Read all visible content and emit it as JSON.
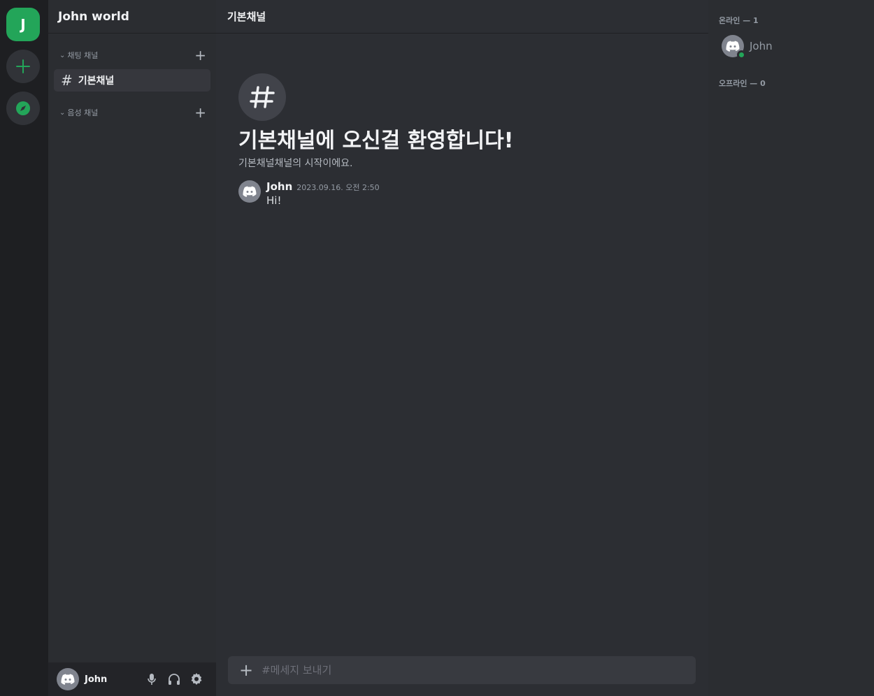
{
  "server_rail": {
    "server_initial": "J",
    "accent_color": "#23a559",
    "add_icon": "plus-icon",
    "explore_icon": "compass-icon"
  },
  "sidebar": {
    "server_name": "John world",
    "categories": [
      {
        "label": "채팅 채널",
        "channels": [
          "기본채널"
        ]
      },
      {
        "label": "음성 채널",
        "channels": []
      }
    ]
  },
  "user_panel": {
    "username": "John",
    "controls": [
      "microphone-icon",
      "headphones-icon",
      "settings-gear-icon"
    ]
  },
  "chat": {
    "header_title": "기본채널",
    "welcome_title": "기본채널에 오신걸 환영합니다!",
    "welcome_subtitle": "기본채널채널의 시작이에요.",
    "messages": [
      {
        "author": "John",
        "timestamp": "2023.09.16. 오전 2:50",
        "text": "Hi!"
      }
    ],
    "composer_placeholder": "#메세지 보내기"
  },
  "members": {
    "online_label": "온라인 — 1",
    "offline_label": "오프라인 — 0",
    "online": [
      {
        "name": "John",
        "status_color": "#23a559"
      }
    ]
  }
}
